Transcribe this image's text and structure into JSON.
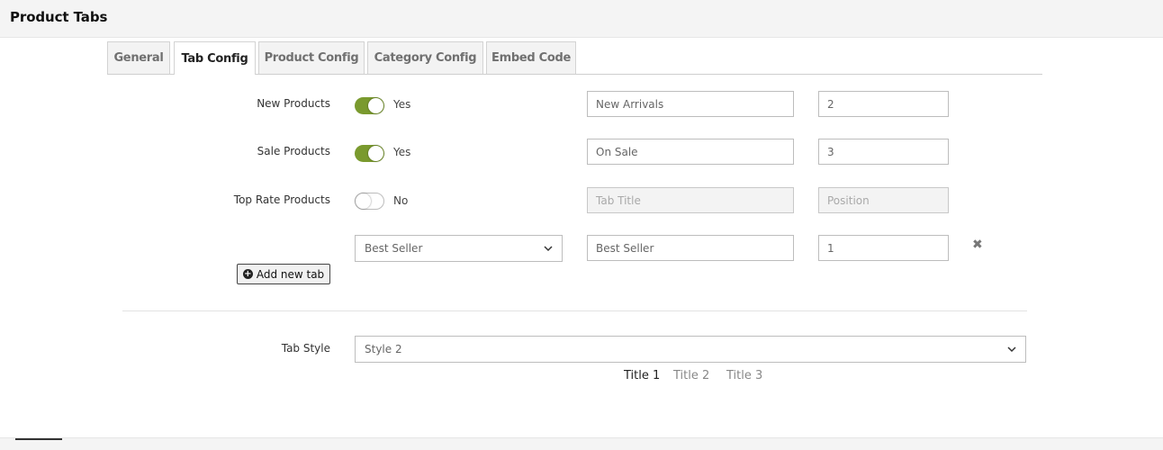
{
  "header": {
    "title": "Product Tabs"
  },
  "tabs": [
    {
      "label": "General",
      "active": false
    },
    {
      "label": "Tab Config",
      "active": true
    },
    {
      "label": "Product Config",
      "active": false
    },
    {
      "label": "Category Config",
      "active": false
    },
    {
      "label": "Embed Code",
      "active": false
    }
  ],
  "rows": [
    {
      "label": "New Products",
      "enabled": true,
      "toggle_text": "Yes",
      "title_value": "New Arrivals",
      "position_value": "2"
    },
    {
      "label": "Sale Products",
      "enabled": true,
      "toggle_text": "Yes",
      "title_value": "On Sale",
      "position_value": "3"
    },
    {
      "label": "Top Rate Products",
      "enabled": false,
      "toggle_text": "No",
      "title_placeholder": "Tab Title",
      "position_placeholder": "Position"
    }
  ],
  "custom_tab": {
    "type_selected": "Best Seller",
    "title_value": "Best Seller",
    "position_value": "1",
    "remove_glyph": "✖"
  },
  "add_button": {
    "label": "Add new tab",
    "icon": "plus-circle-icon"
  },
  "tab_style": {
    "label": "Tab Style",
    "selected": "Style 2",
    "preview_titles": [
      "Title 1",
      "Title 2",
      "Title 3"
    ]
  },
  "colors": {
    "toggle_on": "#7a9a2e",
    "header_bg": "#f4f4f4"
  }
}
